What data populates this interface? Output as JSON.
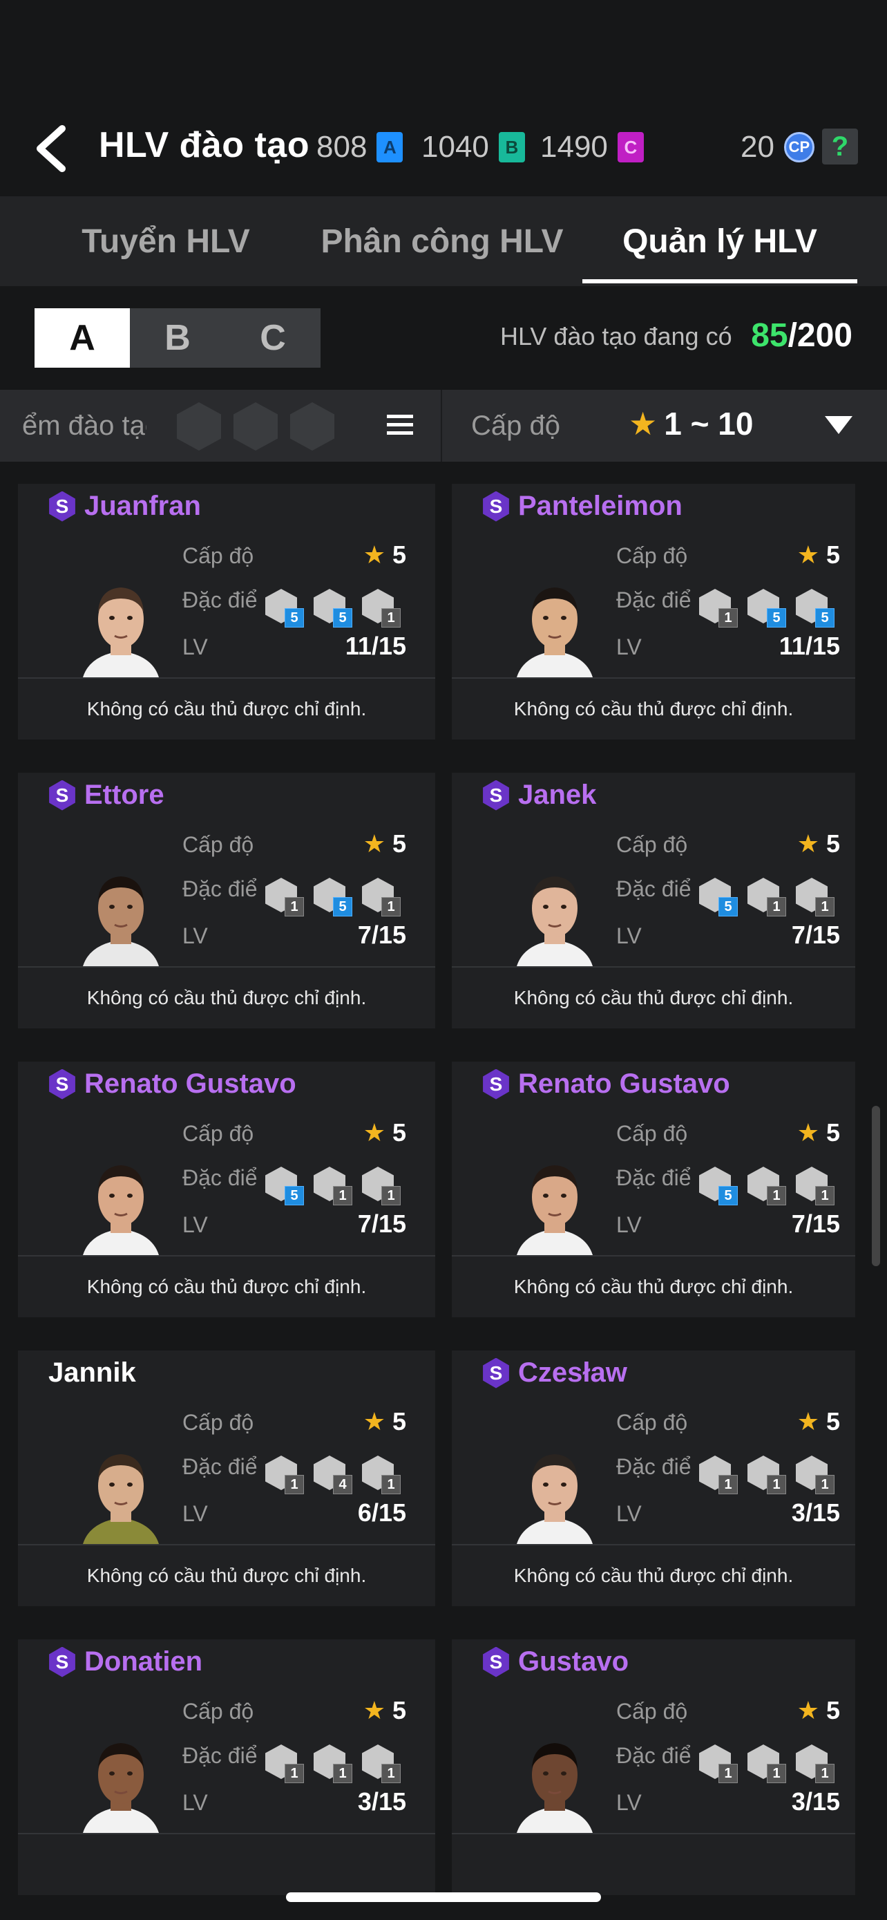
{
  "header": {
    "title": "HLV đào tạo",
    "currencies": [
      {
        "value": "808",
        "letter": "A",
        "color": "#1e90ff"
      },
      {
        "value": "1040",
        "letter": "B",
        "color": "#18b99a"
      },
      {
        "value": "1490",
        "letter": "C",
        "color": "#c01fc4"
      }
    ],
    "cp_value": "20",
    "cp_label": "CP",
    "help_label": "?"
  },
  "tabs": [
    {
      "label": "Tuyển HLV",
      "active": false
    },
    {
      "label": "Phân công HLV",
      "active": false
    },
    {
      "label": "Quản lý HLV",
      "active": true
    }
  ],
  "segments": [
    "A",
    "B",
    "C"
  ],
  "active_segment": "A",
  "coach_count": {
    "label": "HLV đào tạo đang có",
    "current": "85",
    "total": "/200"
  },
  "filter": {
    "trait_text": "ểm đào tạo",
    "level_label": "Cấp độ",
    "level_range": "1 ~ 10"
  },
  "labels": {
    "level": "Cấp độ",
    "trait": "Đặc điểm",
    "lv": "LV"
  },
  "cards": [
    {
      "name": "Juanfran",
      "special": true,
      "level": "5",
      "lv": "11/15",
      "traits": [
        "5",
        "5",
        "1"
      ],
      "trait_blue": [
        true,
        true,
        false
      ],
      "footer": "Không có cầu thủ được chỉ định.",
      "skin": "#e2b89b",
      "hair": "#4a3426",
      "shirt": "#f2f2f2"
    },
    {
      "name": "Panteleimon",
      "special": true,
      "level": "5",
      "lv": "11/15",
      "traits": [
        "1",
        "5",
        "5"
      ],
      "trait_blue": [
        false,
        true,
        true
      ],
      "footer": "Không có cầu thủ được chỉ định.",
      "skin": "#dcae88",
      "hair": "#1b1512",
      "shirt": "#f2f2f2"
    },
    {
      "name": "Ettore",
      "special": true,
      "level": "5",
      "lv": "7/15",
      "traits": [
        "1",
        "5",
        "1"
      ],
      "trait_blue": [
        false,
        true,
        false
      ],
      "footer": "Không có cầu thủ được chỉ định.",
      "skin": "#b88a6a",
      "hair": "#1a120e",
      "shirt": "#e8e8e8"
    },
    {
      "name": "Janek",
      "special": true,
      "level": "5",
      "lv": "7/15",
      "traits": [
        "5",
        "1",
        "1"
      ],
      "trait_blue": [
        true,
        false,
        false
      ],
      "footer": "Không có cầu thủ được chỉ định.",
      "skin": "#e0b59a",
      "hair": "#2a2420",
      "shirt": "#f2f2f2"
    },
    {
      "name": "Renato Gustavo",
      "special": true,
      "level": "5",
      "lv": "7/15",
      "traits": [
        "5",
        "1",
        "1"
      ],
      "trait_blue": [
        true,
        false,
        false
      ],
      "footer": "Không có cầu thủ được chỉ định.",
      "skin": "#d9a888",
      "hair": "#231914",
      "shirt": "#f2f2f2"
    },
    {
      "name": "Renato Gustavo",
      "special": true,
      "level": "5",
      "lv": "7/15",
      "traits": [
        "5",
        "1",
        "1"
      ],
      "trait_blue": [
        true,
        false,
        false
      ],
      "footer": "Không có cầu thủ được chỉ định.",
      "skin": "#d9a888",
      "hair": "#231914",
      "shirt": "#f2f2f2"
    },
    {
      "name": "Jannik",
      "special": false,
      "level": "5",
      "lv": "6/15",
      "traits": [
        "1",
        "4",
        "1"
      ],
      "trait_blue": [
        false,
        false,
        false
      ],
      "footer": "Không có cầu thủ được chỉ định.",
      "skin": "#d7ad8c",
      "hair": "#3a2a1e",
      "shirt": "#8a8a38"
    },
    {
      "name": "Czesław",
      "special": true,
      "level": "5",
      "lv": "3/15",
      "traits": [
        "1",
        "1",
        "1"
      ],
      "trait_blue": [
        false,
        false,
        false
      ],
      "footer": "Không có cầu thủ được chỉ định.",
      "skin": "#e0b59a",
      "hair": "#2a2420",
      "shirt": "#f2f2f2"
    },
    {
      "name": "Donatien",
      "special": true,
      "level": "5",
      "lv": "3/15",
      "traits": [
        "1",
        "1",
        "1"
      ],
      "trait_blue": [
        false,
        false,
        false
      ],
      "footer": "",
      "skin": "#8a5b3e",
      "hair": "#1a120e",
      "shirt": "#f2f2f2"
    },
    {
      "name": "Gustavo",
      "special": true,
      "level": "5",
      "lv": "3/15",
      "traits": [
        "1",
        "1",
        "1"
      ],
      "trait_blue": [
        false,
        false,
        false
      ],
      "footer": "",
      "skin": "#6e4631",
      "hair": "#120c09",
      "shirt": "#f2f2f2"
    }
  ]
}
